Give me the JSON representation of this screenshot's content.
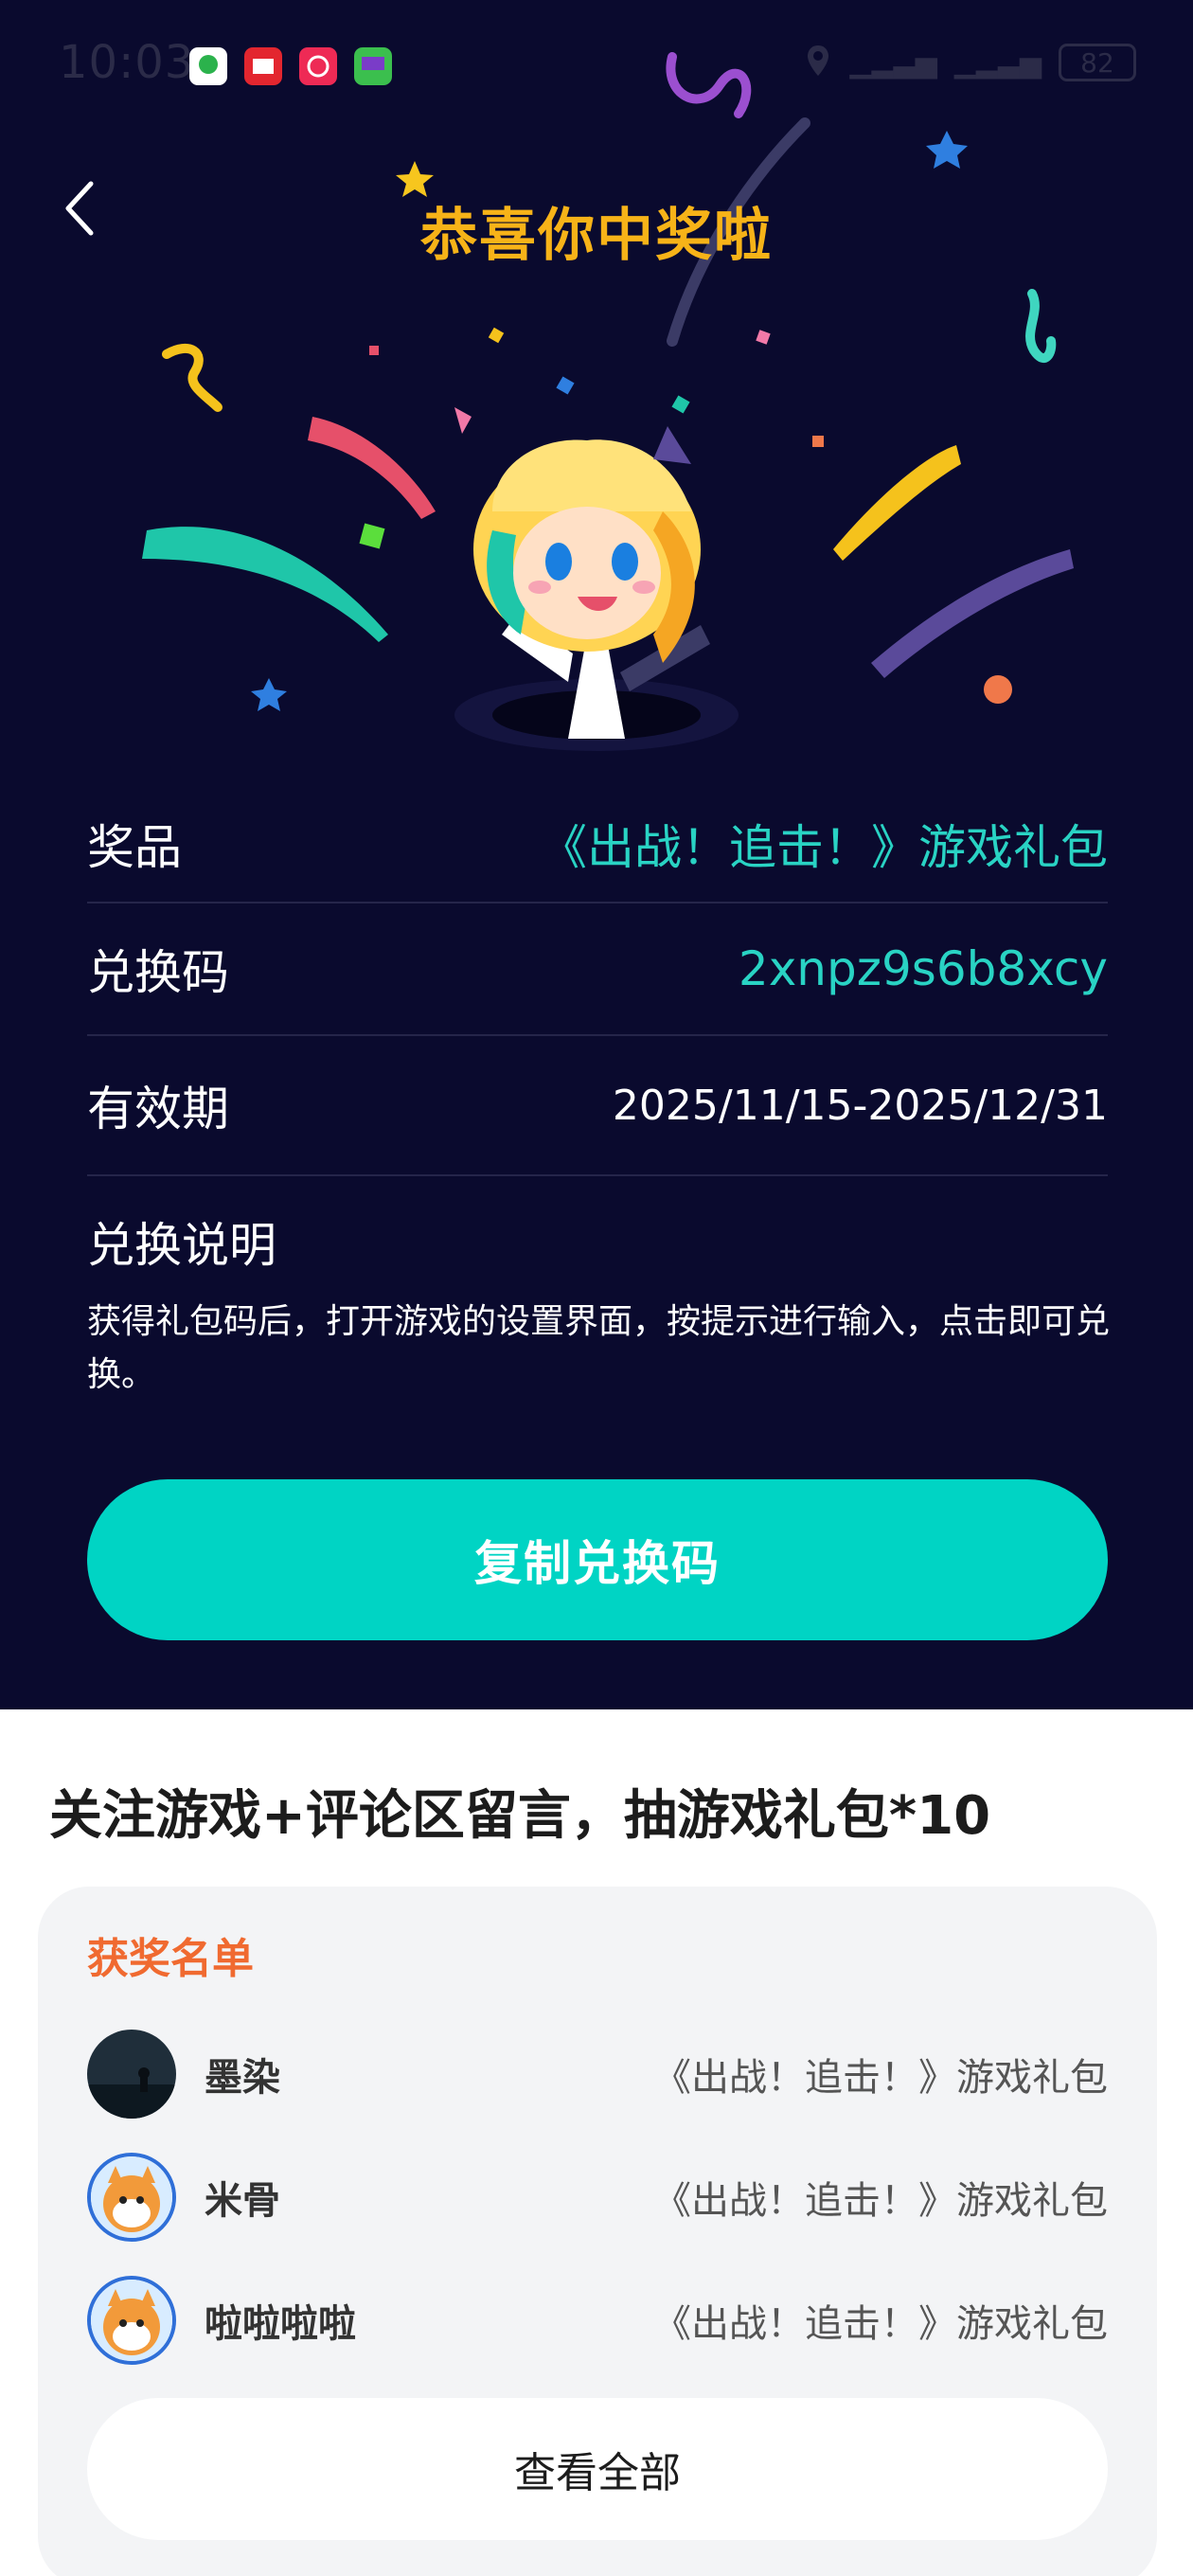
{
  "status_bar": {
    "time": "10:03",
    "battery": "82"
  },
  "header": {
    "title": "恭喜你中奖啦"
  },
  "prize_info": {
    "prize_label": "奖品",
    "prize_value": "《出战！追击！》游戏礼包",
    "code_label": "兑换码",
    "code_value": "2xnpz9s6b8xcy",
    "expire_label": "有效期",
    "expire_value": "2025/11/15-2025/12/31",
    "redeem_title": "兑换说明",
    "redeem_desc": "获得礼包码后，打开游戏的设置界面，按提示进行输入，点击即可兑换。"
  },
  "copy_button": "复制兑换码",
  "lottery": {
    "title": "关注游戏+评论区留言，抽游戏礼包*10",
    "winners_heading": "获奖名单",
    "winners": [
      {
        "name": "墨染",
        "prize": "《出战！追击！》游戏礼包"
      },
      {
        "name": "米骨",
        "prize": "《出战！追击！》游戏礼包"
      },
      {
        "name": "啦啦啦啦",
        "prize": "《出战！追击！》游戏礼包"
      }
    ],
    "view_all": "查看全部"
  },
  "colors": {
    "panel_bg": "#0a0a2e",
    "accent_teal": "#00d4c4",
    "title_gold": "#f7b318",
    "winners_orange": "#f06a30"
  }
}
